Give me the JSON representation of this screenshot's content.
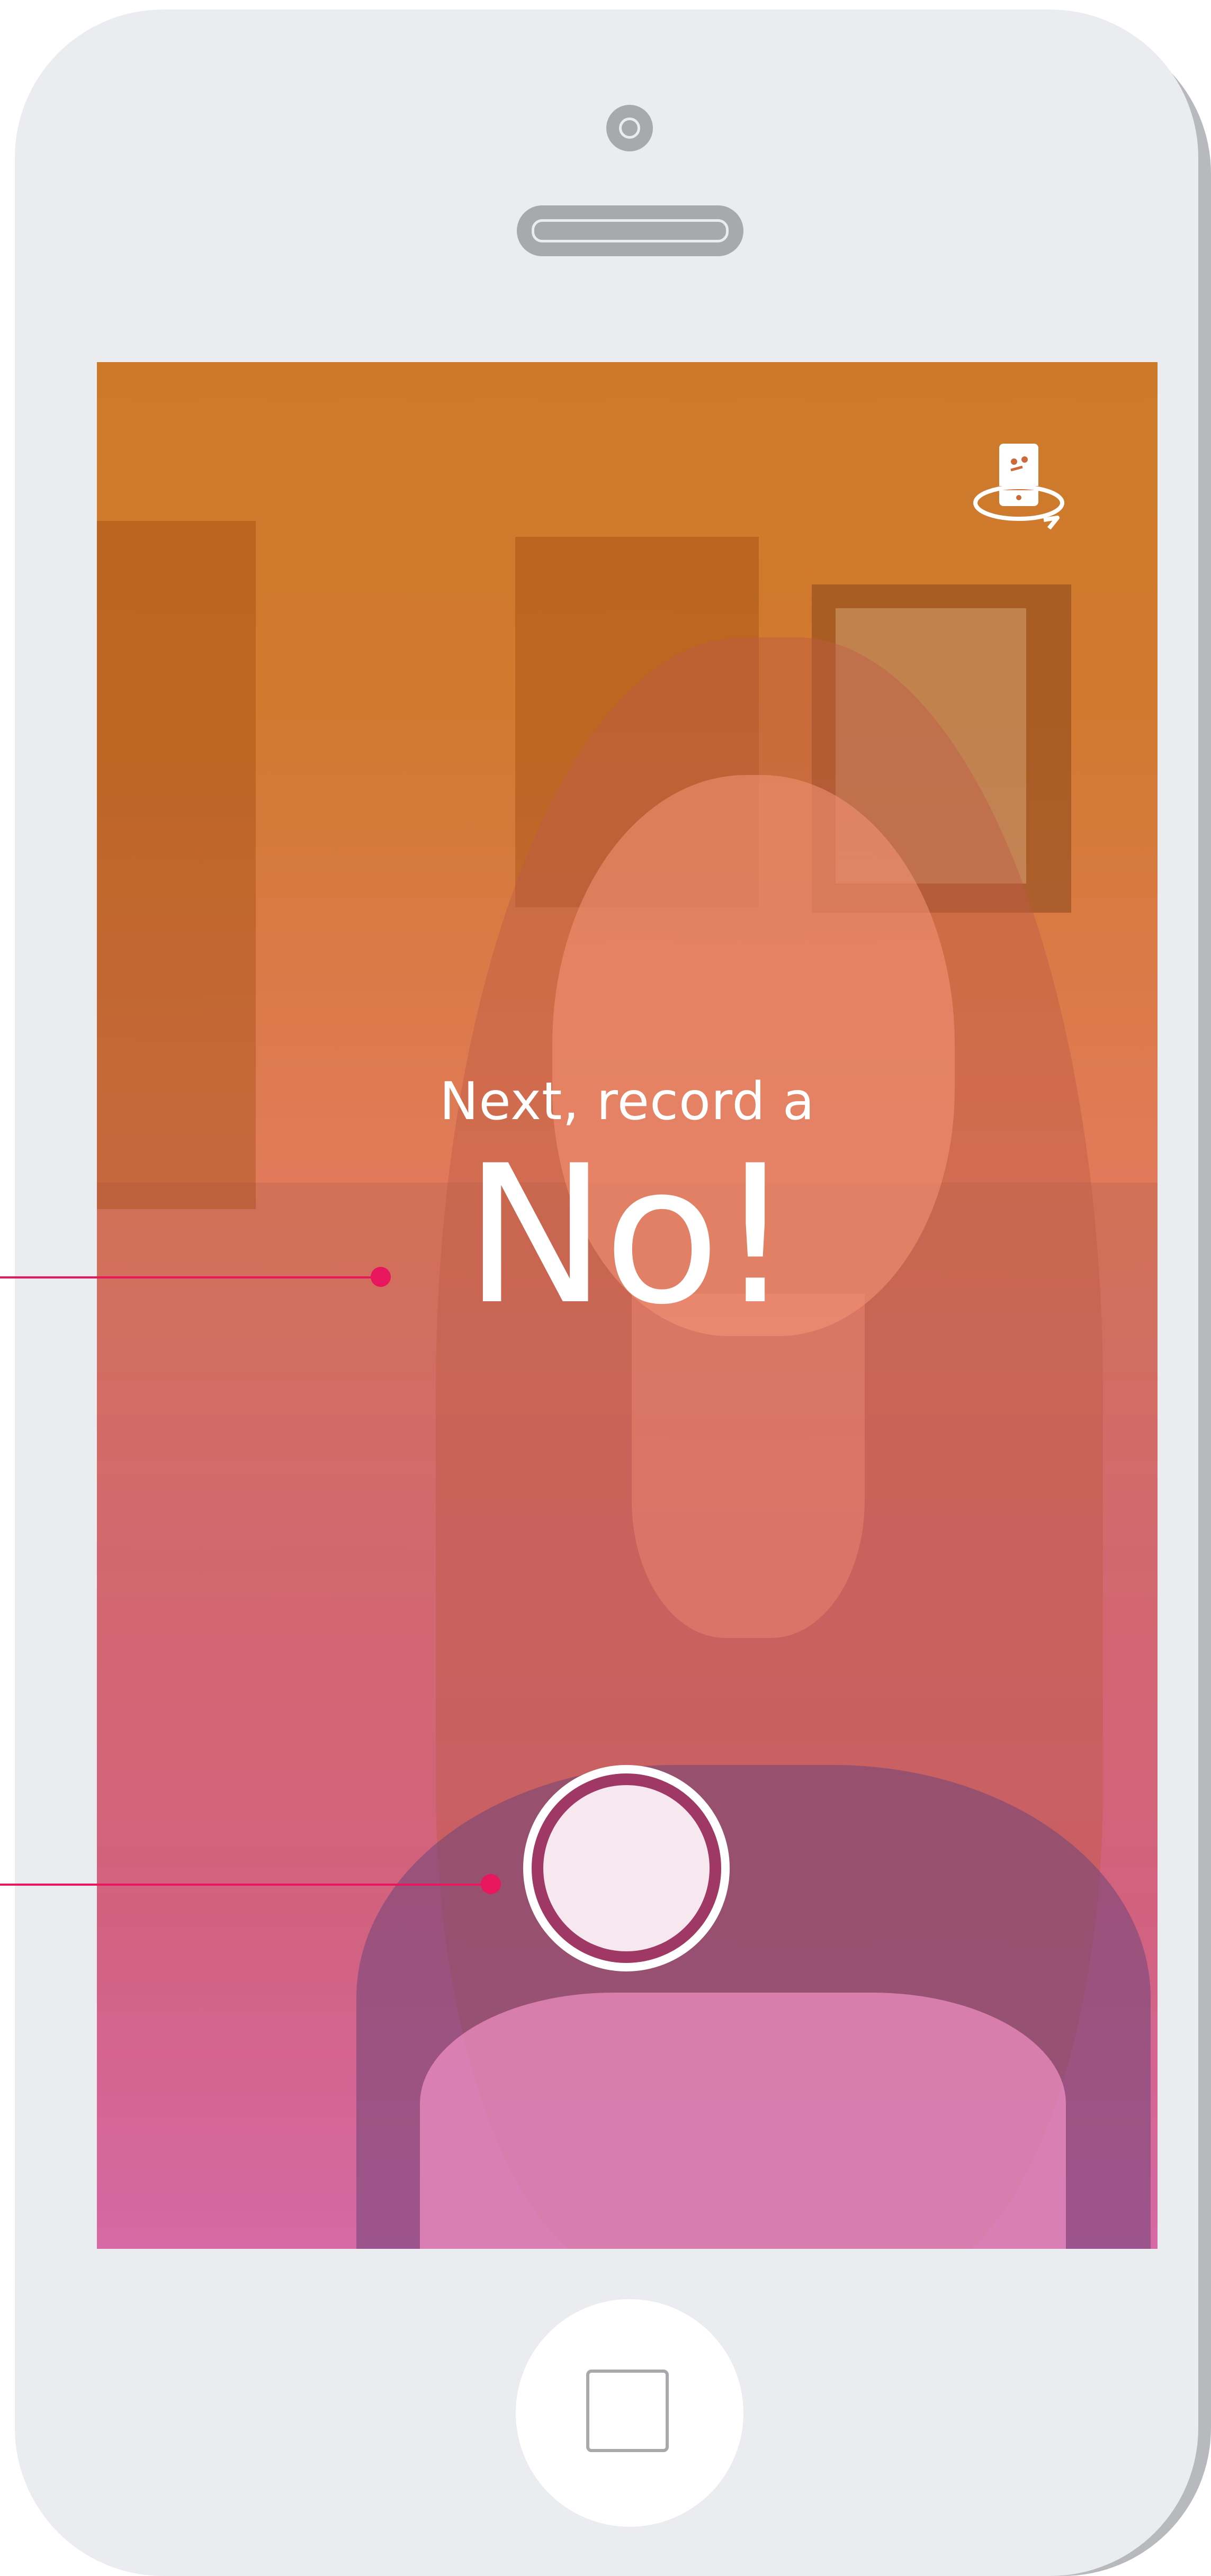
{
  "prompt": {
    "subtitle": "Next, record a",
    "word": "No!"
  },
  "icons": {
    "flip_camera": "flip-camera-icon",
    "record": "record-button-icon",
    "home": "home-button-icon"
  },
  "colors": {
    "annotation": "#e8175d",
    "gradient_top": "#cc7a2a",
    "gradient_bottom": "#e66fc0",
    "record_ring": "#a03865",
    "device_body": "#ebecf0"
  }
}
